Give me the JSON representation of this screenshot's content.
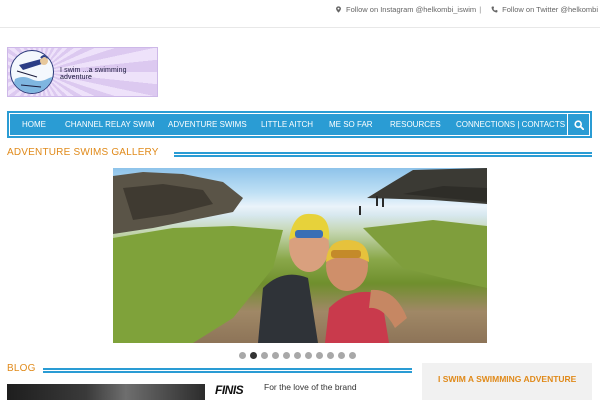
{
  "topbar": {
    "instagram": {
      "icon": "map-marker-icon",
      "label": "Follow on Instagram @helkombi_iswim",
      "separator": "|"
    },
    "twitter": {
      "icon": "phone-icon",
      "label": "Follow on Twitter @helkombi"
    }
  },
  "logo": {
    "text": "I swim ...a swimming adventure"
  },
  "nav": {
    "items": [
      {
        "label": "HOME"
      },
      {
        "label": "CHANNEL RELAY SWIM"
      },
      {
        "label": "ADVENTURE SWIMS"
      },
      {
        "label": "LITTLE AITCH"
      },
      {
        "label": "ME SO FAR"
      },
      {
        "label": "RESOURCES"
      },
      {
        "label": "CONNECTIONS | CONTACTS"
      }
    ],
    "search_icon": "search-icon"
  },
  "gallery": {
    "title": "ADVENTURE SWIMS GALLERY",
    "slide_count": 11,
    "active_slide": 2
  },
  "blog": {
    "title": "BLOG",
    "post": {
      "brand": "FINIS",
      "title": "For the love of the brand"
    }
  },
  "sidebar": {
    "title": "I SWIM A SWIMMING ADVENTURE"
  },
  "colors": {
    "accent": "#2a9cd4",
    "heading": "#e08a1a",
    "dot": "#a8a8a8",
    "dot_active": "#333333"
  }
}
